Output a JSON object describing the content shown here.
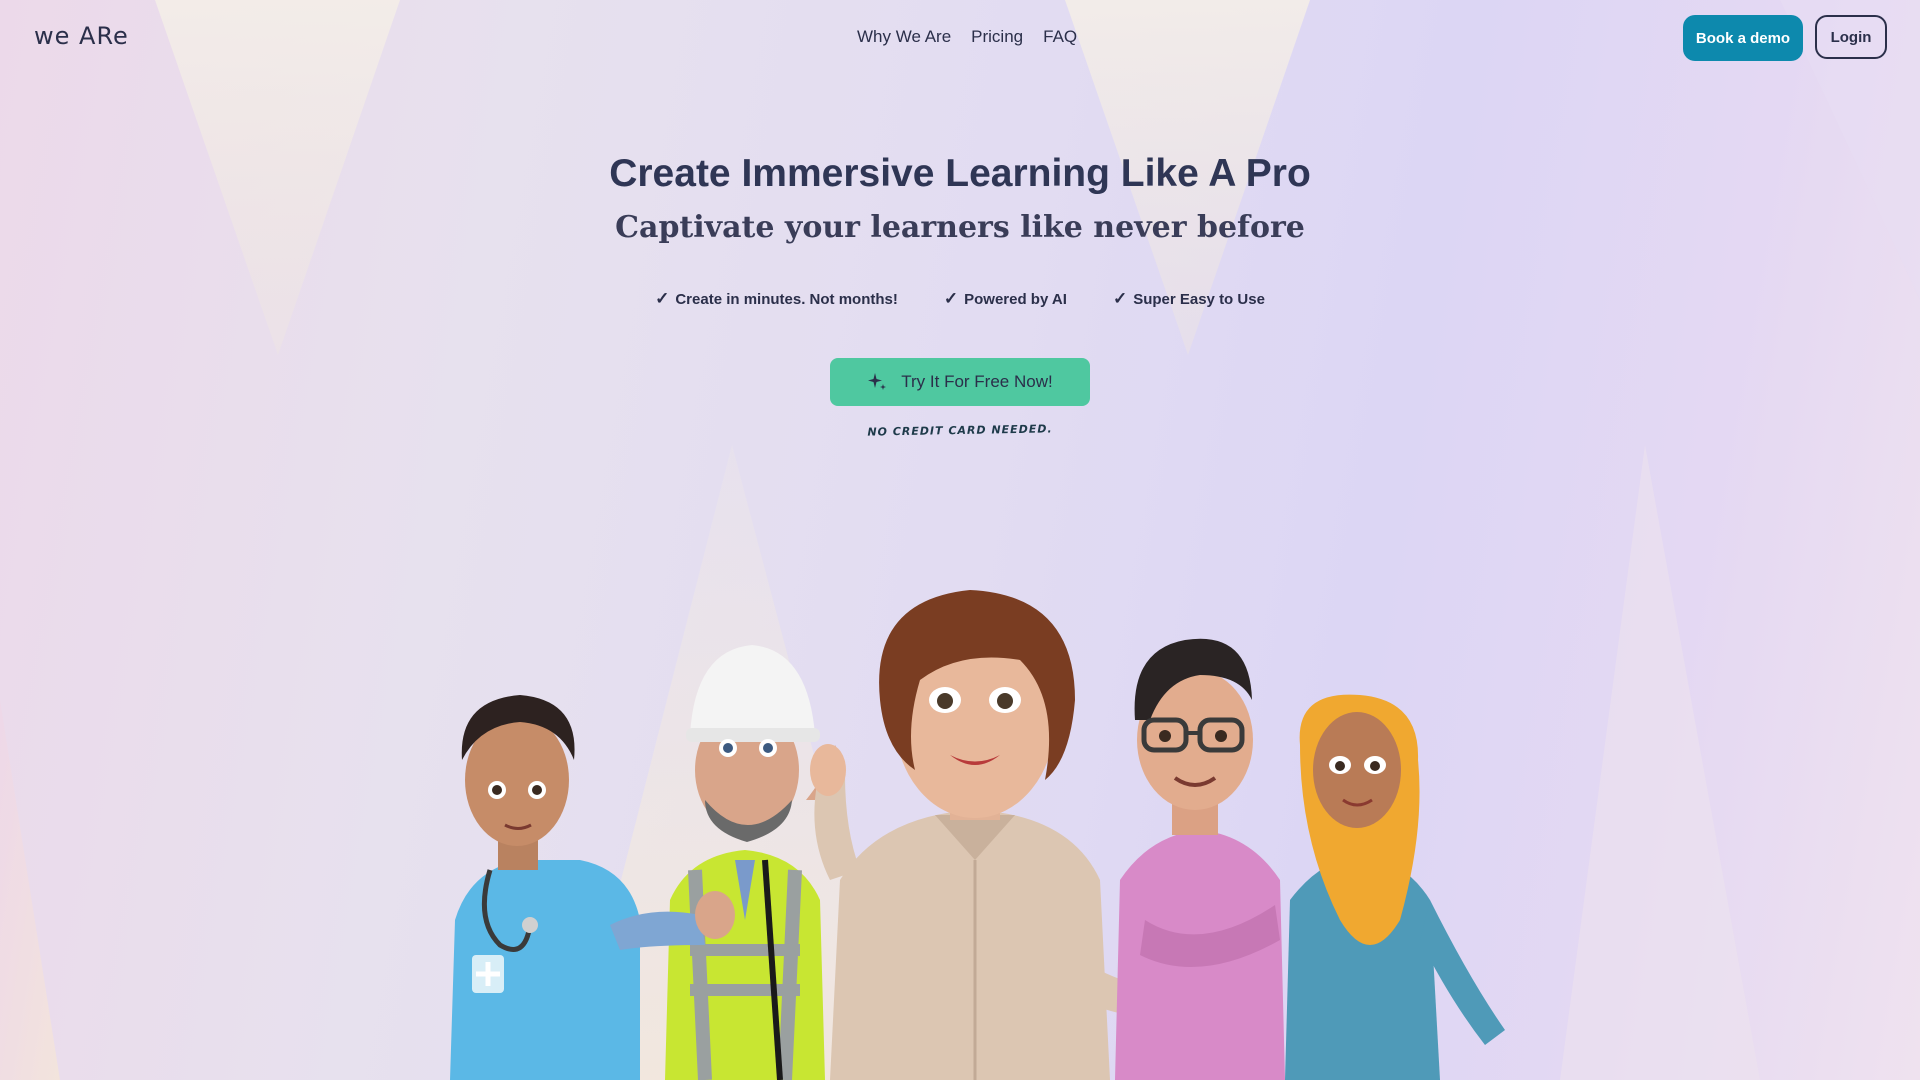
{
  "brand": {
    "logo": "we ARe"
  },
  "nav": {
    "items": [
      "Why We Are",
      "Pricing",
      "FAQ"
    ]
  },
  "header_actions": {
    "book_demo": "Book a demo",
    "login": "Login"
  },
  "hero": {
    "title": "Create Immersive Learning Like A Pro",
    "subtitle": "Captivate your learners like never before",
    "features": [
      "Create in minutes. Not months!",
      "Powered by AI",
      "Super Easy to Use"
    ],
    "cta_label": "Try It For Free Now!",
    "cta_note": "NO CREDIT CARD NEEDED."
  },
  "icons": {
    "check": "check-icon",
    "sparkle": "sparkle-icon"
  },
  "colors": {
    "accent_blue": "#0d89ad",
    "cta_green": "#4fc8a0",
    "text_dark": "#2b2f4a"
  },
  "illustration": {
    "characters": [
      "nurse",
      "construction-worker",
      "woman-presenter",
      "man-with-glasses",
      "woman-in-hijab"
    ]
  }
}
